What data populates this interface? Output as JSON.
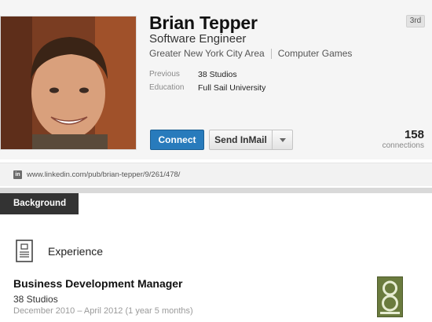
{
  "profile": {
    "name": "Brian Tepper",
    "headline": "Software Engineer",
    "location": "Greater New York City Area",
    "industry": "Computer Games",
    "degree_badge": "3rd",
    "photo_icon": "profile-photo",
    "facts": [
      {
        "label": "Previous",
        "value": "38 Studios"
      },
      {
        "label": "Education",
        "value": "Full Sail University"
      }
    ],
    "connect_label": "Connect",
    "inmail_label": "Send InMail",
    "connections_count": "158",
    "connections_label": "connections"
  },
  "public_url": {
    "icon": "linkedin-icon",
    "text": "www.linkedin.com/pub/brian-tepper/9/261/478/"
  },
  "background": {
    "tab_label": "Background"
  },
  "experience": {
    "section_title": "Experience",
    "section_icon": "document-icon",
    "job": {
      "title": "Business Development Manager",
      "company": "38 Studios",
      "dates": "December 2010 – April 2012 (1 year 5 months)",
      "logo_icon": "company-logo-38-studios"
    }
  },
  "colors": {
    "connect_blue": "#287bbc",
    "background_tab": "#333333"
  }
}
